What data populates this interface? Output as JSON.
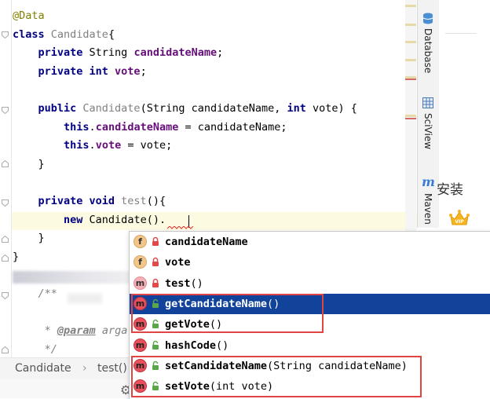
{
  "editor": {
    "lines": [
      {
        "segments": [
          {
            "t": "@Data",
            "c": "ann"
          }
        ]
      },
      {
        "segments": [
          {
            "t": "class ",
            "c": "kw"
          },
          {
            "t": "Candidate",
            "c": "gray"
          },
          {
            "t": "{",
            "c": ""
          }
        ]
      },
      {
        "segments": [
          {
            "t": "    private ",
            "c": "kw"
          },
          {
            "t": "String ",
            "c": ""
          },
          {
            "t": "candidateName",
            "c": "fld"
          },
          {
            "t": ";",
            "c": ""
          }
        ]
      },
      {
        "segments": [
          {
            "t": "    private int ",
            "c": "kw"
          },
          {
            "t": "vote",
            "c": "fld"
          },
          {
            "t": ";",
            "c": ""
          }
        ]
      },
      {
        "segments": []
      },
      {
        "segments": [
          {
            "t": "    public ",
            "c": "kw"
          },
          {
            "t": "Candidate",
            "c": "gray"
          },
          {
            "t": "(String candidateName, ",
            "c": ""
          },
          {
            "t": "int ",
            "c": "kw"
          },
          {
            "t": "vote) {",
            "c": ""
          }
        ]
      },
      {
        "segments": [
          {
            "t": "        this",
            "c": "kw"
          },
          {
            "t": ".",
            "c": ""
          },
          {
            "t": "candidateName",
            "c": "fld"
          },
          {
            "t": " = candidateName;",
            "c": ""
          }
        ]
      },
      {
        "segments": [
          {
            "t": "        this",
            "c": "kw"
          },
          {
            "t": ".",
            "c": ""
          },
          {
            "t": "vote",
            "c": "fld"
          },
          {
            "t": " = vote;",
            "c": ""
          }
        ]
      },
      {
        "segments": [
          {
            "t": "    }",
            "c": ""
          }
        ]
      },
      {
        "segments": []
      },
      {
        "segments": [
          {
            "t": "    private void ",
            "c": "kw"
          },
          {
            "t": "test",
            "c": "gray"
          },
          {
            "t": "(){",
            "c": ""
          }
        ]
      },
      {
        "segments": [
          {
            "t": "        new ",
            "c": "kw"
          },
          {
            "t": "Candidate().",
            "c": ""
          }
        ]
      },
      {
        "segments": [
          {
            "t": "    }",
            "c": ""
          }
        ]
      },
      {
        "segments": [
          {
            "t": "}",
            "c": ""
          }
        ]
      },
      {
        "segments": []
      },
      {
        "segments": [
          {
            "t": "    /**",
            "c": "cmt"
          }
        ]
      },
      {
        "segments": []
      },
      {
        "segments": [
          {
            "t": "     * ",
            "c": "cmt"
          },
          {
            "t": "@param",
            "c": "tag"
          },
          {
            "t": " arga",
            "c": "cmt"
          }
        ]
      },
      {
        "segments": [
          {
            "t": "     */",
            "c": "cmt"
          }
        ]
      }
    ]
  },
  "breadcrumb": {
    "class_name": "Candidate",
    "separator": "›",
    "method_name": "test()"
  },
  "side_tabs": [
    {
      "label": "Database",
      "icon": "database-icon"
    },
    {
      "label": "SciView",
      "icon": "table-icon"
    },
    {
      "label": "Maven",
      "icon": "maven-icon"
    }
  ],
  "right_panel": {
    "text": "安装",
    "badge": "VIP"
  },
  "completion": {
    "items": [
      {
        "kind": "f",
        "name": "candidateName",
        "params": "",
        "visibility": "private",
        "selected": false
      },
      {
        "kind": "f",
        "name": "vote",
        "params": "",
        "visibility": "private",
        "selected": false
      },
      {
        "kind": "m-dim",
        "name": "test",
        "params": "()",
        "visibility": "private",
        "selected": false
      },
      {
        "kind": "m",
        "name": "getCandidateName",
        "params": "()",
        "visibility": "public",
        "selected": true
      },
      {
        "kind": "m",
        "name": "getVote",
        "params": "()",
        "visibility": "public",
        "selected": false
      },
      {
        "kind": "m",
        "name": "hashCode",
        "params": "()",
        "visibility": "public",
        "selected": false
      },
      {
        "kind": "m",
        "name": "setCandidateName",
        "params": "(String candidateName)",
        "visibility": "public",
        "selected": false
      },
      {
        "kind": "m",
        "name": "setVote",
        "params": "(int vote)",
        "visibility": "public",
        "selected": false
      }
    ]
  },
  "colors": {
    "selection": "#12439a",
    "highlight_box": "#e04545",
    "keyword": "#000080",
    "field": "#660e7a",
    "annotation": "#808000"
  }
}
